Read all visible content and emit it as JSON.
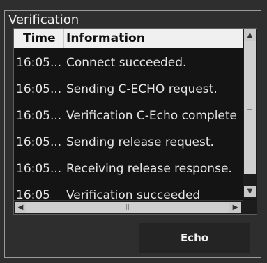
{
  "group": {
    "title": "Verification"
  },
  "table": {
    "columns": [
      "Time",
      "Information"
    ],
    "rows": [
      {
        "time": "16:05...",
        "info": "Connect succeeded."
      },
      {
        "time": "16:05...",
        "info": "Sending C-ECHO request."
      },
      {
        "time": "16:05...",
        "info": "Verification C-Echo complete"
      },
      {
        "time": "16:05...",
        "info": "Sending release request."
      },
      {
        "time": "16:05...",
        "info": "Receiving release response."
      },
      {
        "time": "16:05",
        "info": "Verification succeeded"
      }
    ]
  },
  "buttons": {
    "echo": "Echo"
  }
}
